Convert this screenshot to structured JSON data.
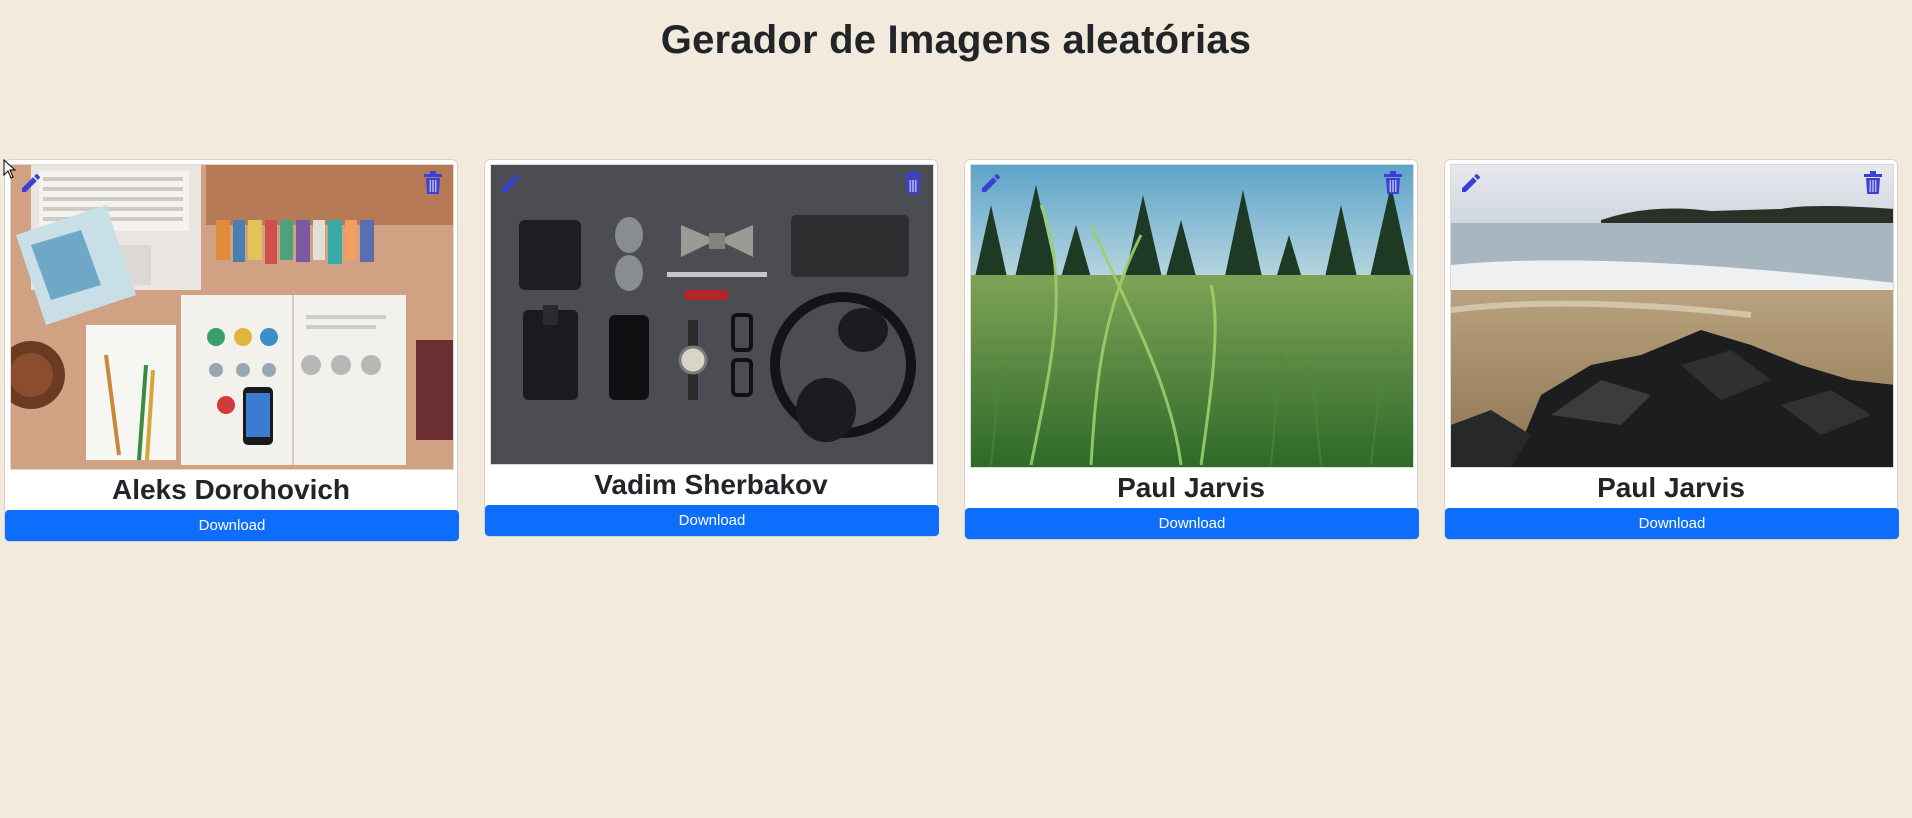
{
  "page": {
    "title": "Gerador de Imagens aleatórias",
    "background_color": "#f2eadc",
    "accent_color": "#0d6efd",
    "icon_color": "#3a3fd6"
  },
  "cards": [
    {
      "author": "Aleks Dorohovich",
      "download_label": "Download",
      "edit_icon": "pencil-icon",
      "delete_icon": "trash-icon",
      "image_subject": "desk-flatlay"
    },
    {
      "author": "Vadim Sherbakov",
      "download_label": "Download",
      "edit_icon": "pencil-icon",
      "delete_icon": "trash-icon",
      "image_subject": "accessories-flatlay"
    },
    {
      "author": "Paul Jarvis",
      "download_label": "Download",
      "edit_icon": "pencil-icon",
      "delete_icon": "trash-icon",
      "image_subject": "grass-field"
    },
    {
      "author": "Paul Jarvis",
      "download_label": "Download",
      "edit_icon": "pencil-icon",
      "delete_icon": "trash-icon",
      "image_subject": "rocky-beach"
    }
  ]
}
